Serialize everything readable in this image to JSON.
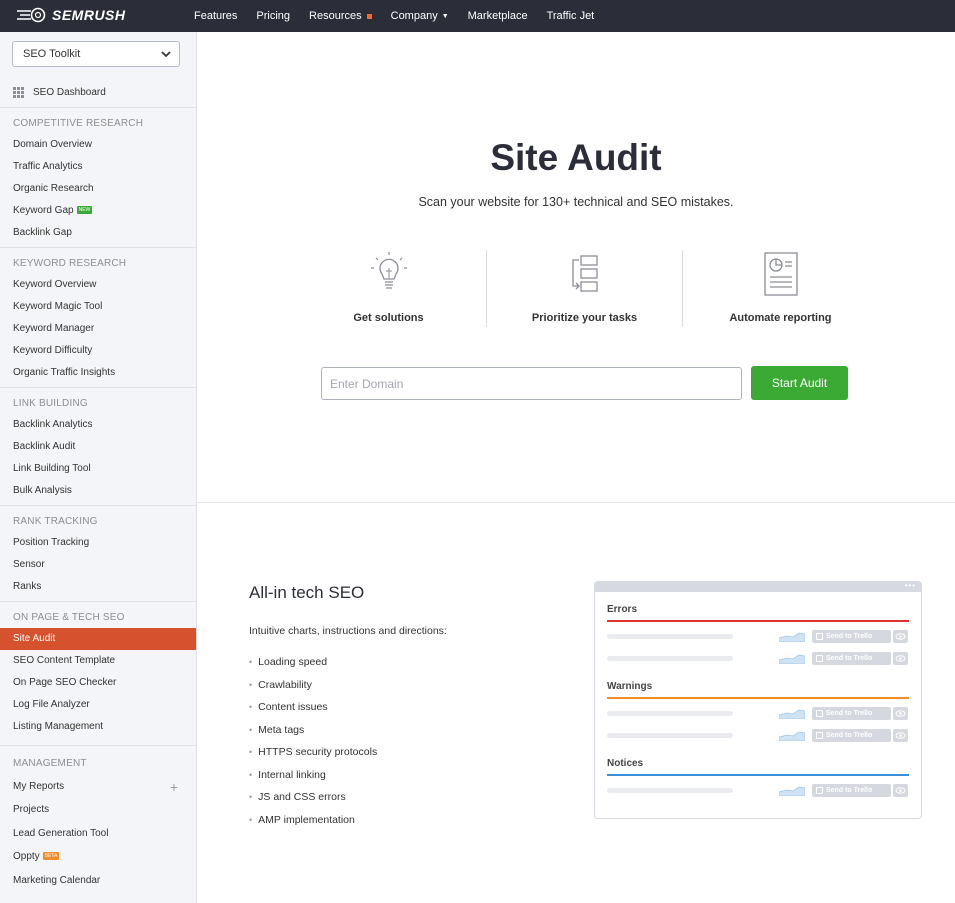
{
  "brand": {
    "name": "SEMRUSH"
  },
  "nav": [
    "Features",
    "Pricing",
    "Resources",
    "Company",
    "Marketplace",
    "Traffic Jet"
  ],
  "sidebar": {
    "toolkit": "SEO Toolkit",
    "dashboard": "SEO Dashboard",
    "sections": {
      "competitive": "COMPETITIVE RESEARCH",
      "keyword": "KEYWORD RESEARCH",
      "link": "LINK BUILDING",
      "rank": "RANK TRACKING",
      "onpage": "ON PAGE & TECH SEO",
      "management": "MANAGEMENT"
    },
    "items": {
      "domain_overview": "Domain Overview",
      "traffic_analytics": "Traffic Analytics",
      "organic_research": "Organic Research",
      "keyword_gap": "Keyword Gap",
      "backlink_gap": "Backlink Gap",
      "keyword_overview": "Keyword Overview",
      "keyword_magic": "Keyword Magic Tool",
      "keyword_manager": "Keyword Manager",
      "keyword_difficulty": "Keyword Difficulty",
      "organic_traffic_insights": "Organic Traffic Insights",
      "backlink_analytics": "Backlink Analytics",
      "backlink_audit": "Backlink Audit",
      "link_building_tool": "Link Building Tool",
      "bulk_analysis": "Bulk Analysis",
      "position_tracking": "Position Tracking",
      "sensor": "Sensor",
      "ranks": "Ranks",
      "site_audit": "Site Audit",
      "seo_content_template": "SEO Content Template",
      "on_page_checker": "On Page SEO Checker",
      "log_file_analyzer": "Log File Analyzer",
      "listing_management": "Listing Management",
      "my_reports": "My Reports",
      "projects": "Projects",
      "lead_generation": "Lead Generation Tool",
      "oppty": "Oppty",
      "marketing_calendar": "Marketing Calendar"
    },
    "badges": {
      "new": "NEW",
      "beta": "BETA"
    }
  },
  "hero": {
    "title": "Site Audit",
    "subtitle": "Scan your website for 130+ technical and SEO mistakes.",
    "features": [
      "Get solutions",
      "Prioritize your tasks",
      "Automate reporting"
    ],
    "input_placeholder": "Enter Domain",
    "button": "Start Audit"
  },
  "tech": {
    "title": "All-in tech SEO",
    "description": "Intuitive charts, instructions and directions:",
    "bullets": [
      "Loading speed",
      "Crawlability",
      "Content issues",
      "Meta tags",
      "HTTPS security protocols",
      "Internal linking",
      "JS and CSS errors",
      "AMP implementation"
    ]
  },
  "preview": {
    "errors": "Errors",
    "warnings": "Warnings",
    "notices": "Notices",
    "trello": "Send to Trello"
  },
  "colors": {
    "accent": "#d6522f",
    "green": "#3aaa35",
    "error": "#e0322a",
    "warning": "#f28c2b",
    "notice": "#3a8fd9",
    "topbar": "#2b2e38"
  }
}
